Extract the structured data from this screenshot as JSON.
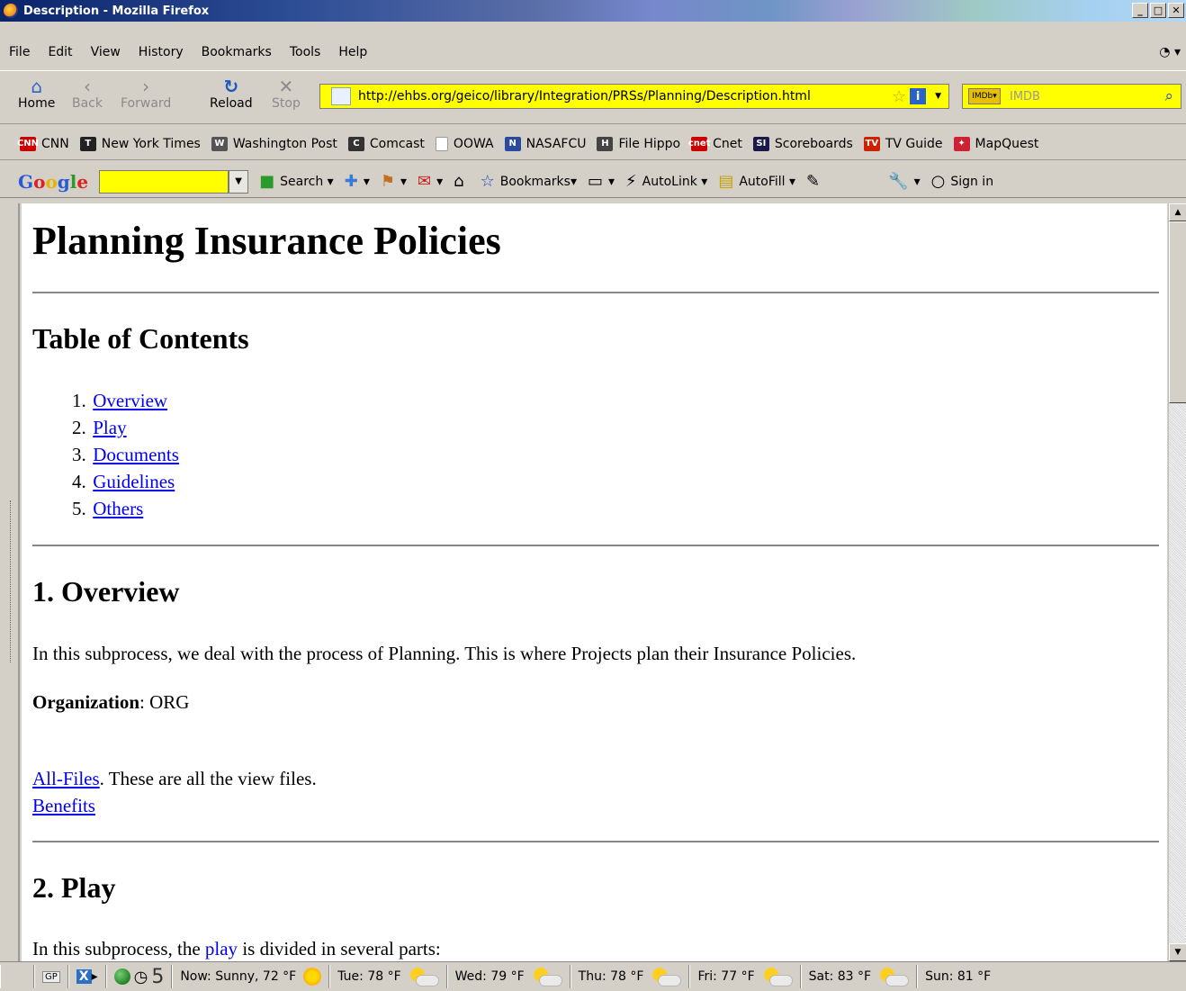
{
  "window": {
    "title": "Description - Mozilla Firefox"
  },
  "menu": [
    "File",
    "Edit",
    "View",
    "History",
    "Bookmarks",
    "Tools",
    "Help"
  ],
  "nav": {
    "home": "Home",
    "back": "Back",
    "forward": "Forward",
    "reload": "Reload",
    "stop": "Stop",
    "url": "http://ehbs.org/geico/library/Integration/PRSs/Planning/Description.html",
    "search_placeholder": "IMDB"
  },
  "bookmarks": [
    {
      "label": "CNN",
      "icon": "cnn-icon",
      "color": "#cc0000",
      "glyph": "CNN"
    },
    {
      "label": "New York Times",
      "icon": "nyt-icon",
      "color": "#222222",
      "glyph": "T"
    },
    {
      "label": "Washington Post",
      "icon": "wapo-icon",
      "color": "#555555",
      "glyph": "W"
    },
    {
      "label": "Comcast",
      "icon": "comcast-icon",
      "color": "#333333",
      "glyph": "C"
    },
    {
      "label": "OOWA",
      "icon": "page-icon",
      "color": "#ffffff",
      "glyph": ""
    },
    {
      "label": "NASAFCU",
      "icon": "nasafcu-icon",
      "color": "#2a4aa0",
      "glyph": "N"
    },
    {
      "label": "File Hippo",
      "icon": "filehippo-icon",
      "color": "#444444",
      "glyph": "H"
    },
    {
      "label": "Cnet",
      "icon": "cnet-icon",
      "color": "#cc0000",
      "glyph": "cnet"
    },
    {
      "label": "Scoreboards",
      "icon": "si-icon",
      "color": "#1a1a4a",
      "glyph": "SI"
    },
    {
      "label": "TV Guide",
      "icon": "tvguide-icon",
      "color": "#cc2200",
      "glyph": "TV"
    },
    {
      "label": "MapQuest",
      "icon": "mapquest-icon",
      "color": "#cc2233",
      "glyph": "✦"
    }
  ],
  "google_toolbar": {
    "logo": "Google",
    "search": "Search",
    "bookmarks": "Bookmarks",
    "autolink": "AutoLink",
    "autofill": "AutoFill",
    "signin": "Sign in"
  },
  "page": {
    "title": "Planning Insurance Policies",
    "toc_heading": "Table of Contents",
    "toc": [
      "Overview",
      "Play",
      "Documents",
      "Guidelines",
      "Others"
    ],
    "overview_heading": "1. Overview",
    "overview_text": "In this subprocess, we deal with the process of Planning. This is where Projects plan their Insurance Policies.",
    "org_label": "Organization",
    "org_value": ": ORG",
    "allfiles_link": "All-Files",
    "allfiles_text": ". These are all the view files.",
    "benefits_link": "Benefits",
    "play_heading": "2. Play",
    "play_text_pre": "In this subprocess, the ",
    "play_link": "play",
    "play_text_post": " is divided in several parts:"
  },
  "status": {
    "count": "5",
    "weather": [
      {
        "label": "Now: Sunny, 72 °F",
        "icon": "sun-icon"
      },
      {
        "label": "Tue: 78 °F",
        "icon": "partly-cloudy-icon"
      },
      {
        "label": "Wed: 79 °F",
        "icon": "partly-cloudy-icon"
      },
      {
        "label": "Thu: 78 °F",
        "icon": "partly-cloudy-icon"
      },
      {
        "label": "Fri: 77 °F",
        "icon": "partly-cloudy-icon"
      },
      {
        "label": "Sat: 83 °F",
        "icon": "partly-cloudy-icon"
      },
      {
        "label": "Sun: 81 °F",
        "icon": "partly-cloudy-icon"
      }
    ]
  }
}
